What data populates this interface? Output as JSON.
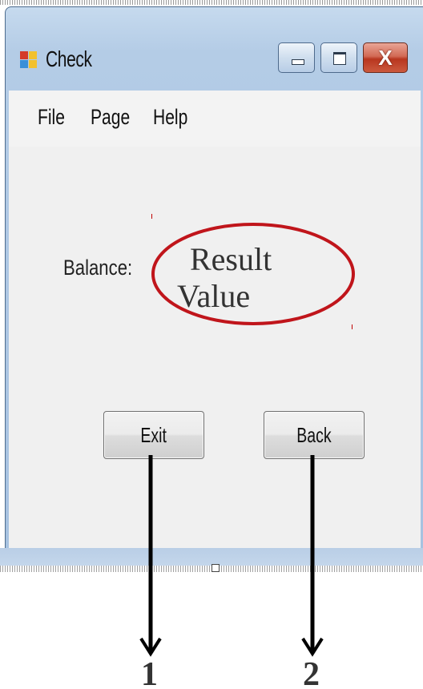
{
  "window": {
    "title": "Check",
    "controls": {
      "minimize_icon": "minimize-icon",
      "maximize_icon": "maximize-icon",
      "close_icon": "close-icon",
      "close_glyph": "X"
    }
  },
  "menu": {
    "items": [
      {
        "label": "File"
      },
      {
        "label": "Page"
      },
      {
        "label": "Help"
      }
    ]
  },
  "form": {
    "balance_label": "Balance:",
    "result_line1": "Result",
    "result_line2": "Value",
    "exit_button": "Exit",
    "back_button": "Back"
  },
  "annotations": {
    "callout_1": "1",
    "callout_2": "2",
    "highlight_color": "#c0151b"
  },
  "colors": {
    "client_background": "#f0f0f0",
    "frame_blue": "#b4cce6",
    "close_red": "#c9452c"
  }
}
